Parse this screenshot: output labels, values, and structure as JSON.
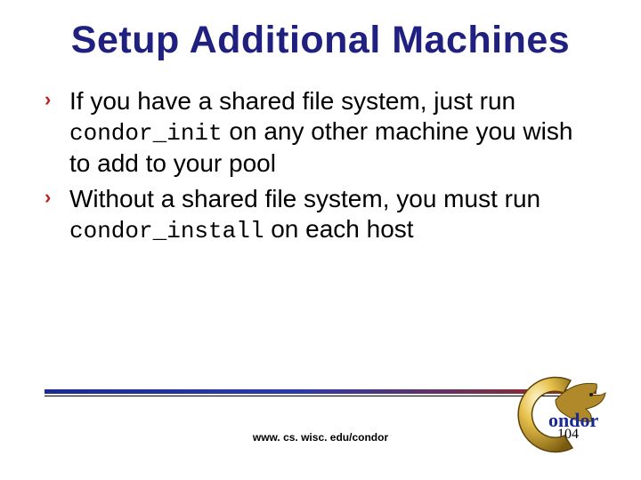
{
  "title": "Setup Additional Machines",
  "bullets": [
    {
      "pre": "If you have a shared file system, just run ",
      "code": "condor_init",
      "post": " on any other machine you wish to add to your pool"
    },
    {
      "pre": "Without a shared file system, you must run ",
      "code": "condor_install",
      "post": " on each host"
    }
  ],
  "footer_url": "www. cs. wisc. edu/condor",
  "page_number": "104",
  "logo_text": "Condor",
  "bullet_marker": "›"
}
